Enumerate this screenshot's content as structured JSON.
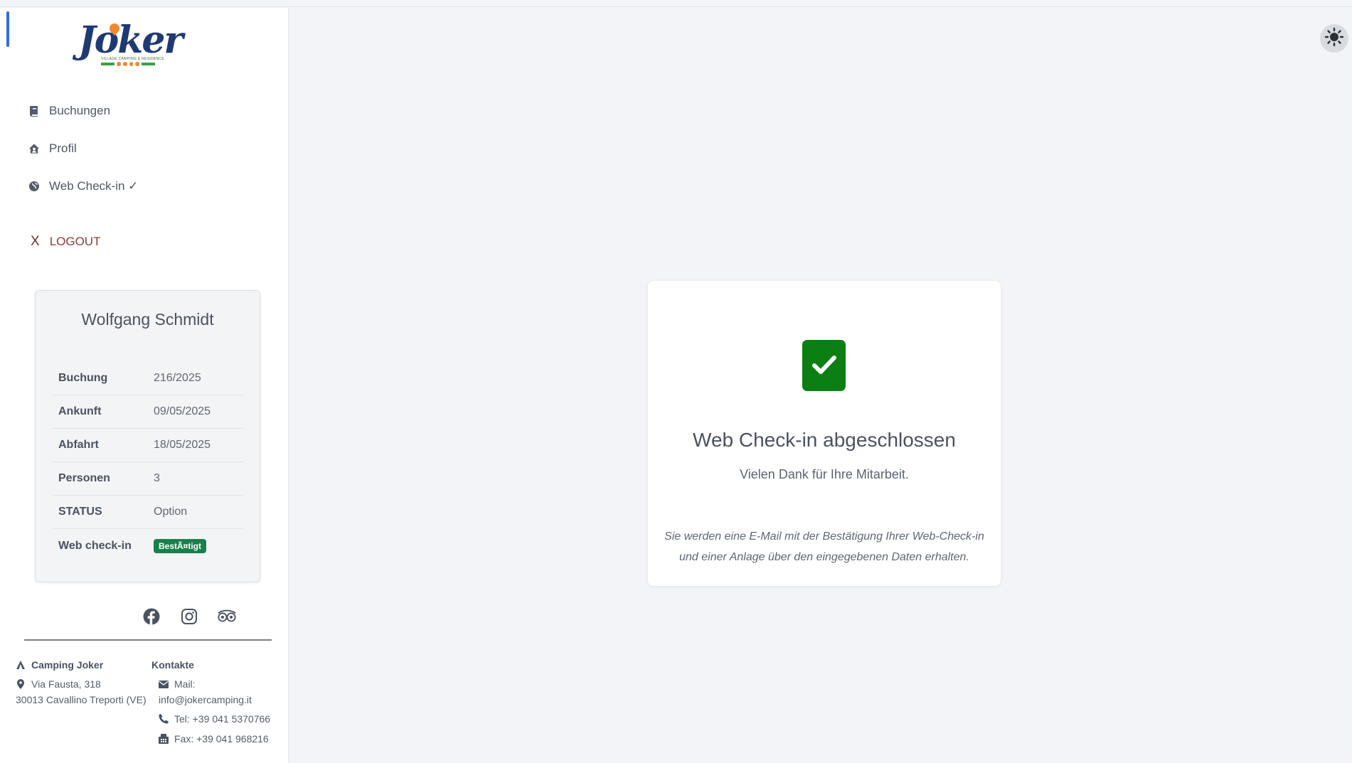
{
  "brand": {
    "logo_text": "Joker",
    "logo_subtext": "VILLAGE CAMPING & RESIDENCE"
  },
  "nav": {
    "items": [
      {
        "label": "Buchungen",
        "icon": "book-icon"
      },
      {
        "label": "Profil",
        "icon": "home-user-icon"
      },
      {
        "label": "Web Check-in ✓",
        "icon": "globe-icon"
      }
    ],
    "logout_label": "LOGOUT",
    "logout_icon": "X"
  },
  "guest": {
    "name": "Wolfgang Schmidt",
    "rows": [
      {
        "label": "Buchung",
        "value": "216/2025"
      },
      {
        "label": "Ankunft",
        "value": "09/05/2025"
      },
      {
        "label": "Abfahrt",
        "value": "18/05/2025"
      },
      {
        "label": "Personen",
        "value": "3"
      },
      {
        "label": "STATUS",
        "value": "Option"
      },
      {
        "label": "Web check-in",
        "badge": "BestÃ¤tigt"
      }
    ],
    "badge_color": "#1a7f4a"
  },
  "socials": [
    "facebook-icon",
    "instagram-icon",
    "tripadvisor-icon"
  ],
  "footer": {
    "company": {
      "title": "Camping Joker",
      "address_line1": "Via Fausta, 318",
      "address_line2": "30013 Cavallino Treporti (VE)"
    },
    "contacts": {
      "title": "Kontakte",
      "mail_label": "Mail:",
      "mail_value": "info@jokercamping.it",
      "tel": "Tel: +39 041 5370766",
      "fax": "Fax: +39 041 968216"
    }
  },
  "main": {
    "title": "Web Check-in abgeschlossen",
    "subtitle": "Vielen Dank für Ihre Mitarbeit.",
    "note": "Sie werden eine E-Mail mit der Bestätigung Ihrer Web-Check-in und einer Anlage über den eingegebenen Daten erhalten.",
    "success_color": "#0b7f14"
  }
}
